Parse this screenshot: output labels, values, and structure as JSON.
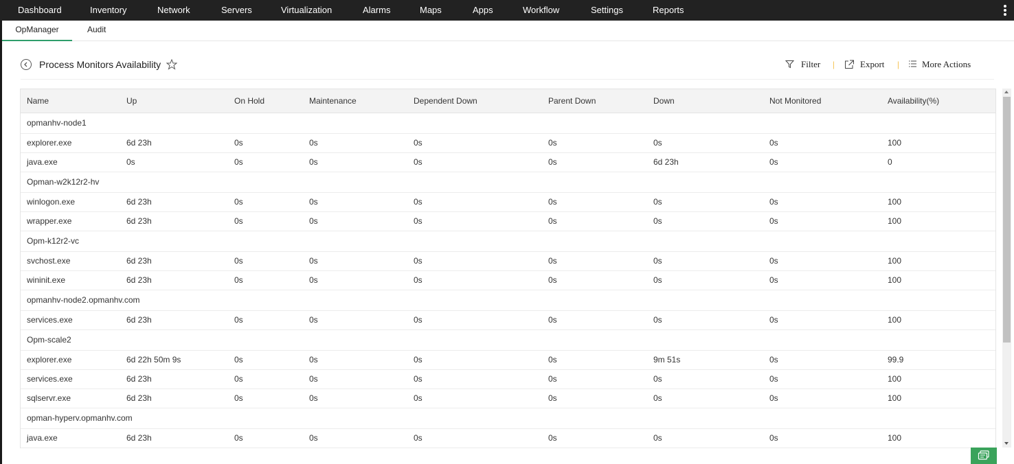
{
  "topnav": {
    "items": [
      "Dashboard",
      "Inventory",
      "Network",
      "Servers",
      "Virtualization",
      "Alarms",
      "Maps",
      "Apps",
      "Workflow",
      "Settings",
      "Reports"
    ]
  },
  "subnav": {
    "items": [
      "OpManager",
      "Audit"
    ],
    "active": "OpManager"
  },
  "page": {
    "title": "Process Monitors Availability"
  },
  "actions": {
    "filter": "Filter",
    "export": "Export",
    "more": "More Actions",
    "separator": "|"
  },
  "table": {
    "columns": [
      "Name",
      "Up",
      "On Hold",
      "Maintenance",
      "Dependent Down",
      "Parent Down",
      "Down",
      "Not Monitored",
      "Availability(%)"
    ],
    "rows": [
      {
        "group": "opmanhv-node1"
      },
      {
        "cells": [
          "explorer.exe",
          "6d 23h",
          "0s",
          "0s",
          "0s",
          "0s",
          "0s",
          "0s",
          "100"
        ]
      },
      {
        "cells": [
          "java.exe",
          "0s",
          "0s",
          "0s",
          "0s",
          "0s",
          "6d 23h",
          "0s",
          "0"
        ]
      },
      {
        "group": "Opman-w2k12r2-hv"
      },
      {
        "cells": [
          "winlogon.exe",
          "6d 23h",
          "0s",
          "0s",
          "0s",
          "0s",
          "0s",
          "0s",
          "100"
        ]
      },
      {
        "cells": [
          "wrapper.exe",
          "6d 23h",
          "0s",
          "0s",
          "0s",
          "0s",
          "0s",
          "0s",
          "100"
        ]
      },
      {
        "group": "Opm-k12r2-vc"
      },
      {
        "cells": [
          "svchost.exe",
          "6d 23h",
          "0s",
          "0s",
          "0s",
          "0s",
          "0s",
          "0s",
          "100"
        ]
      },
      {
        "cells": [
          "wininit.exe",
          "6d 23h",
          "0s",
          "0s",
          "0s",
          "0s",
          "0s",
          "0s",
          "100"
        ]
      },
      {
        "group": "opmanhv-node2.opmanhv.com"
      },
      {
        "cells": [
          "services.exe",
          "6d 23h",
          "0s",
          "0s",
          "0s",
          "0s",
          "0s",
          "0s",
          "100"
        ]
      },
      {
        "group": "Opm-scale2"
      },
      {
        "cells": [
          "explorer.exe",
          "6d 22h 50m 9s",
          "0s",
          "0s",
          "0s",
          "0s",
          "9m 51s",
          "0s",
          "99.9"
        ]
      },
      {
        "cells": [
          "services.exe",
          "6d 23h",
          "0s",
          "0s",
          "0s",
          "0s",
          "0s",
          "0s",
          "100"
        ]
      },
      {
        "cells": [
          "sqlservr.exe",
          "6d 23h",
          "0s",
          "0s",
          "0s",
          "0s",
          "0s",
          "0s",
          "100"
        ]
      },
      {
        "group": "opman-hyperv.opmanhv.com"
      },
      {
        "cells": [
          "java.exe",
          "6d 23h",
          "0s",
          "0s",
          "0s",
          "0s",
          "0s",
          "0s",
          "100"
        ]
      }
    ]
  },
  "colors": {
    "topnav_bg": "#222222",
    "accent_green": "#2e9e6b",
    "separator": "#f0a500",
    "chat_bg": "#3aa35b"
  },
  "icons": {
    "back": "back-circle-icon",
    "star": "star-icon",
    "filter": "filter-icon",
    "export": "export-icon",
    "more": "list-icon",
    "kebab": "kebab-icon",
    "chat": "chat-icon"
  }
}
